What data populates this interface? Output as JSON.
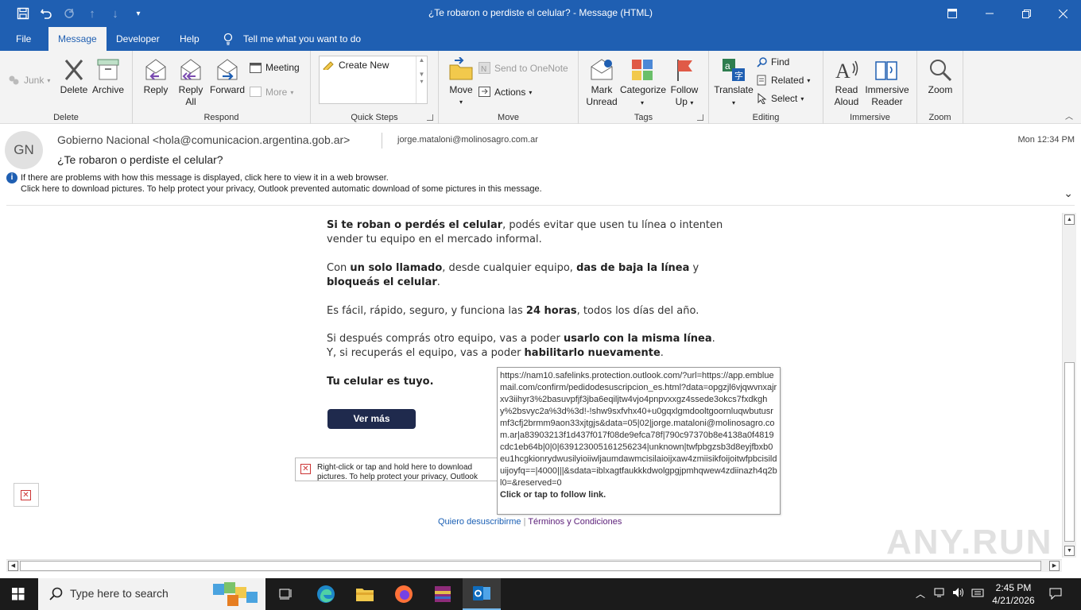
{
  "window": {
    "title": "¿Te robaron o perdiste el celular?  -  Message (HTML)"
  },
  "menu_tabs": [
    "File",
    "Message",
    "Developer",
    "Help"
  ],
  "tell_me": "Tell me what you want to do",
  "ribbon": {
    "junk": "Junk",
    "delete": "Delete",
    "archive": "Archive",
    "group_delete": "Delete",
    "reply": "Reply",
    "reply_all_1": "Reply",
    "reply_all_2": "All",
    "forward": "Forward",
    "meeting": "Meeting",
    "more": "More",
    "group_respond": "Respond",
    "create_new": "Create New",
    "group_quick_steps": "Quick Steps",
    "move": "Move",
    "send_onenote": "Send to OneNote",
    "actions": "Actions",
    "group_move": "Move",
    "mark_unread_1": "Mark",
    "mark_unread_2": "Unread",
    "categorize": "Categorize",
    "follow_up_1": "Follow",
    "follow_up_2": "Up",
    "group_tags": "Tags",
    "translate": "Translate",
    "find": "Find",
    "related": "Related",
    "select": "Select",
    "group_editing": "Editing",
    "read_aloud_1": "Read",
    "read_aloud_2": "Aloud",
    "immersive_reader_1": "Immersive",
    "immersive_reader_2": "Reader",
    "group_immersive": "Immersive",
    "zoom": "Zoom",
    "group_zoom": "Zoom"
  },
  "message": {
    "avatar_initials": "GN",
    "sender": "Gobierno Nacional <hola@comunicacion.argentina.gob.ar>",
    "recipient": "jorge.mataloni@molinosagro.com.ar",
    "time": "Mon 12:34 PM",
    "subject": "¿Te robaron o perdiste el celular?",
    "info_line1": "If there are problems with how this message is displayed, click here to view it in a web browser.",
    "info_line2": "Click here to download pictures. To help protect your privacy, Outlook prevented automatic download of some pictures in this message."
  },
  "body": {
    "p1_bold": "Si te roban o perdés el celular",
    "p1_rest": ", podés evitar que usen tu línea o intenten vender tu equipo en el mercado informal.",
    "p2_a": "Con ",
    "p2_b": "un solo llamado",
    "p2_c": ", desde cualquier equipo, ",
    "p2_d": "das de baja la línea",
    "p2_e": " y ",
    "p2_f": "bloqueás el celular",
    "p2_g": ".",
    "p3_a": "Es fácil, rápido, seguro, y funciona las ",
    "p3_b": "24 horas",
    "p3_c": ", todos los días del año.",
    "p4_a": "Si después comprás otro equipo, vas a poder ",
    "p4_b": "usarlo con la misma línea",
    "p4_c": ". Y, si recuperás el equipo, vas a poder ",
    "p4_d": "habilitarlo nuevamente",
    "p4_e": ".",
    "p5": "Tu celular es tuyo.",
    "cta": "Ver más",
    "broken_image_text": "Right-click or tap and hold here to download pictures. To help protect your privacy, Outlook prevented automatic download of this picture from the Internet.",
    "link_unsubscribe": "Quiero desuscribirme",
    "link_sep": "|",
    "link_terms": "Términos y Condiciones"
  },
  "tooltip": {
    "url": "https://nam10.safelinks.protection.outlook.com/?url=https://app.embluemail.com/confirm/pedidodesuscripcion_es.html?data=opgzjl6vjqwvnxajrxv3iihyr3%2basuvpfjf3jba6eqiljtw4vjo4pnpvxxgz4ssede3okcs7fxdkghy%2bsvyc2a%3d%3d!-!shw9sxfvhx40+u0gqxlgmdooltgoornluqwbutusrmf3cfj2brmm9aon33xjtgjs&data=05|02|jorge.mataloni@molinosagro.com.ar|a83903213f1d437f017f08de9efca78f|790c97370b8e4138a0f4819cdc1eb64b|0|0|639123005161256234|unknown|twfpbgzsb3d8eyjfbxb0eu1hcgkionrydwusilyioiiwljaumdawmcisilaioijxaw4zmiisikfoijoitwfpbcisilduijoyfq==|4000|||&sdata=iblxagtfaukkkdwolgpgjpmhqwew4zdiinazh4q2bl0=&reserved=0",
    "follow": "Click or tap to follow link."
  },
  "watermark": "ANY.RUN",
  "taskbar": {
    "search_placeholder": "Type here to search",
    "clock_time": "2:45 PM",
    "clock_date": "4/21/2026"
  },
  "colors": {
    "titlebar": "#1f5fb2",
    "cta": "#1f2a4d",
    "taskbar": "#1b1b1b"
  }
}
